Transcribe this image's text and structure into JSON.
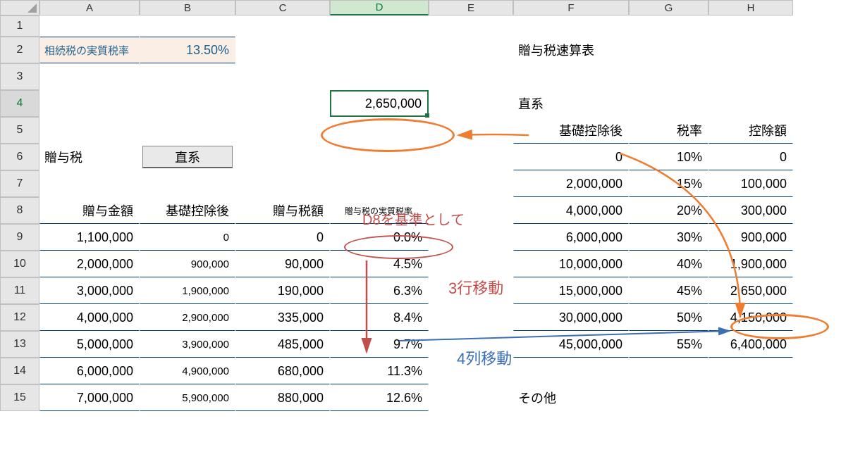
{
  "columns": [
    "A",
    "B",
    "C",
    "D",
    "E",
    "F",
    "G",
    "H"
  ],
  "rows": [
    "1",
    "2",
    "3",
    "4",
    "5",
    "6",
    "7",
    "8",
    "9",
    "10",
    "11",
    "12",
    "13",
    "14",
    "15"
  ],
  "activeCell": "D4",
  "A2": "相続税の実質税率",
  "B2": "13.50%",
  "D4": "2,650,000",
  "F2": "贈与税速算表",
  "F4": "直系",
  "F5": "基礎控除後",
  "G5": "税率",
  "H5": "控除額",
  "A6": "贈与税",
  "B6_button": "直系",
  "A8": "贈与金額",
  "B8": "基礎控除後",
  "C8": "贈与税額",
  "D8_label": "贈与税の実質税率",
  "F15": "その他",
  "leftTable": [
    {
      "a": "1,100,000",
      "b": "0",
      "c": "0",
      "d": "0.0%"
    },
    {
      "a": "2,000,000",
      "b": "900,000",
      "c": "90,000",
      "d": "4.5%"
    },
    {
      "a": "3,000,000",
      "b": "1,900,000",
      "c": "190,000",
      "d": "6.3%"
    },
    {
      "a": "4,000,000",
      "b": "2,900,000",
      "c": "335,000",
      "d": "8.4%"
    },
    {
      "a": "5,000,000",
      "b": "3,900,000",
      "c": "485,000",
      "d": "9.7%"
    },
    {
      "a": "6,000,000",
      "b": "4,900,000",
      "c": "680,000",
      "d": "11.3%"
    },
    {
      "a": "7,000,000",
      "b": "5,900,000",
      "c": "880,000",
      "d": "12.6%"
    }
  ],
  "rightTable": [
    {
      "f": "0",
      "g": "10%",
      "h": "0"
    },
    {
      "f": "2,000,000",
      "g": "15%",
      "h": "100,000"
    },
    {
      "f": "4,000,000",
      "g": "20%",
      "h": "300,000"
    },
    {
      "f": "6,000,000",
      "g": "30%",
      "h": "900,000"
    },
    {
      "f": "10,000,000",
      "g": "40%",
      "h": "1,900,000"
    },
    {
      "f": "15,000,000",
      "g": "45%",
      "h": "2,650,000"
    },
    {
      "f": "30,000,000",
      "g": "50%",
      "h": "4,150,000"
    },
    {
      "f": "45,000,000",
      "g": "55%",
      "h": "6,400,000"
    }
  ],
  "anno1": "D8を基準として",
  "anno2": "3行移動",
  "anno3": "4列移動"
}
